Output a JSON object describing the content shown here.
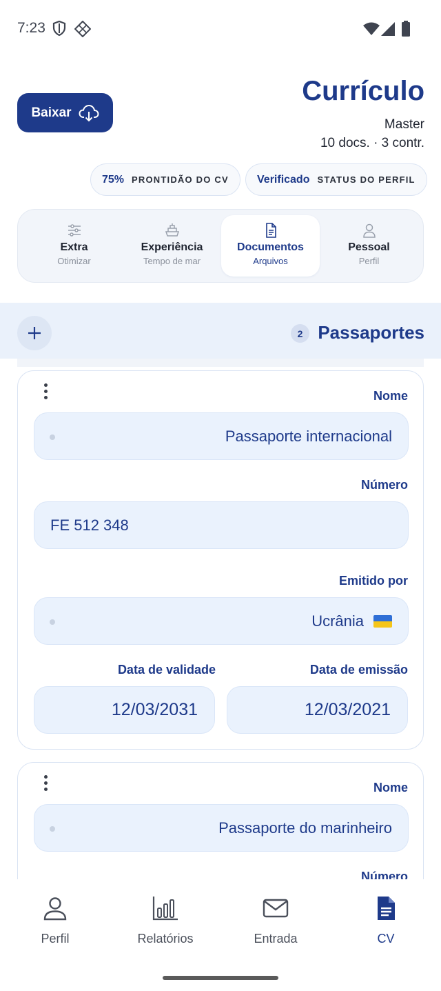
{
  "status_bar": {
    "time": "7:23"
  },
  "header": {
    "download_label": "Baixar",
    "title": "Currículo",
    "rank": "Master",
    "summary": "10 docs. · 3 contr."
  },
  "chips": [
    {
      "value": "75%",
      "label": "PRONTIDÃO DO CV"
    },
    {
      "value": "Verificado",
      "label": "STATUS DO PERFIL"
    }
  ],
  "tabs": [
    {
      "label": "Extra",
      "sub": "Otimizar",
      "icon": "sliders-icon"
    },
    {
      "label": "Experiência",
      "sub": "Tempo de mar",
      "icon": "ship-icon"
    },
    {
      "label": "Documentos",
      "sub": "Arquivos",
      "icon": "document-icon",
      "active": true
    },
    {
      "label": "Pessoal",
      "sub": "Perfil",
      "icon": "person-icon"
    }
  ],
  "section": {
    "title": "Passaportes",
    "count": "2"
  },
  "cards": [
    {
      "name_label": "Nome",
      "name_value": "Passaporte internacional",
      "number_label": "Número",
      "number_value": "FE 512 348",
      "issued_by_label": "Emitido por",
      "issued_by_value": "Ucrânia",
      "expiry_label": "Data de validade",
      "expiry_value": "12/03/2031",
      "issue_label": "Data de emissão",
      "issue_value": "12/03/2021"
    },
    {
      "name_label": "Nome",
      "name_value": "Passaporte do marinheiro",
      "number_label": "Número"
    }
  ],
  "bottom_nav": [
    {
      "label": "Perfil",
      "icon": "person-icon"
    },
    {
      "label": "Relatórios",
      "icon": "bar-chart-icon"
    },
    {
      "label": "Entrada",
      "icon": "mail-icon"
    },
    {
      "label": "CV",
      "icon": "document-filled-icon",
      "active": true
    }
  ],
  "colors": {
    "accent": "#1e3a8a",
    "field_bg": "#eaf2fd",
    "section_bg": "#eaf1fb"
  }
}
